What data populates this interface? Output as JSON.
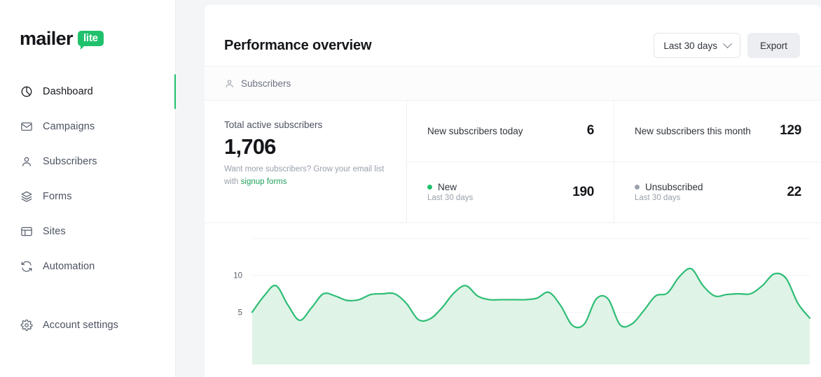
{
  "brand": {
    "name": "mailer",
    "badge": "lite"
  },
  "sidebar": {
    "items": [
      {
        "label": "Dashboard",
        "icon": "pie-chart-icon",
        "active": true
      },
      {
        "label": "Campaigns",
        "icon": "envelope-icon",
        "active": false
      },
      {
        "label": "Subscribers",
        "icon": "user-icon",
        "active": false
      },
      {
        "label": "Forms",
        "icon": "layers-icon",
        "active": false
      },
      {
        "label": "Sites",
        "icon": "window-icon",
        "active": false
      },
      {
        "label": "Automation",
        "icon": "refresh-icon",
        "active": false
      }
    ],
    "footer_item": {
      "label": "Account settings",
      "icon": "gear-icon"
    }
  },
  "header": {
    "title": "Performance overview",
    "date_filter": {
      "value": "Last 30 days",
      "icon": "chevron-down-icon"
    },
    "export_label": "Export"
  },
  "tabs": [
    {
      "label": "Subscribers",
      "icon": "user-icon",
      "active": true
    }
  ],
  "stats": {
    "total": {
      "caption": "Total active subscribers",
      "value": "1,706",
      "promo_prefix": "Want more subscribers? Grow your email list with ",
      "promo_link": "signup forms"
    },
    "cells": [
      {
        "label": "New subscribers today",
        "value": "6",
        "dot": null,
        "period": null
      },
      {
        "label": "New subscribers this month",
        "value": "129",
        "dot": null,
        "period": null
      },
      {
        "label": "New",
        "value": "190",
        "dot": "#20c16c",
        "period": "Last 30 days"
      },
      {
        "label": "Unsubscribed",
        "value": "22",
        "dot": "#9aa1ab",
        "period": "Last 30 days"
      }
    ]
  },
  "colors": {
    "accent": "#20c16c",
    "line": "#2ebd75",
    "area": "#dff3e7",
    "gray": "#9aa1ab"
  },
  "chart_data": {
    "type": "area",
    "title": "",
    "xlabel": "",
    "ylabel": "",
    "ylim": [
      0,
      15
    ],
    "grid": true,
    "yticks": [
      5,
      10
    ],
    "ytick_labels": [
      "5",
      "10"
    ],
    "legend": [
      "New"
    ],
    "series": [
      {
        "name": "New",
        "color": "#2ebd75",
        "values": [
          5.0,
          7.2,
          8.6,
          6.0,
          3.9,
          5.6,
          7.5,
          7.2,
          6.6,
          6.7,
          7.4,
          7.5,
          7.5,
          6.2,
          4.0,
          4.1,
          5.6,
          7.6,
          8.6,
          7.2,
          6.7,
          6.7,
          6.7,
          6.7,
          6.9,
          7.7,
          5.9,
          3.2,
          3.4,
          6.8,
          6.8,
          3.3,
          3.4,
          5.2,
          7.2,
          7.6,
          9.8,
          10.9,
          8.6,
          7.2,
          7.4,
          7.5,
          7.5,
          8.6,
          10.2,
          9.6,
          6.2,
          4.2
        ]
      }
    ]
  }
}
